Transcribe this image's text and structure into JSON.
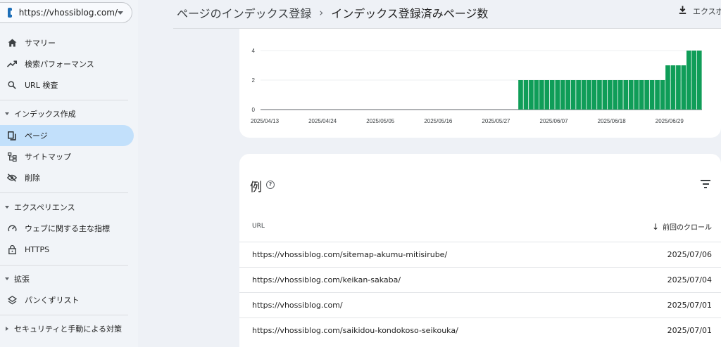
{
  "property": {
    "url": "https://vhossiblog.com/"
  },
  "sidebar": {
    "items": [
      {
        "label": "サマリー",
        "icon": "home-icon"
      },
      {
        "label": "検索パフォーマンス",
        "icon": "trending-up-icon"
      },
      {
        "label": "URL 検査",
        "icon": "search-icon"
      }
    ],
    "sections": [
      {
        "label": "インデックス作成",
        "items": [
          {
            "label": "ページ",
            "icon": "pages-icon",
            "active": true
          },
          {
            "label": "サイトマップ",
            "icon": "sitemap-icon"
          },
          {
            "label": "削除",
            "icon": "eye-off-icon"
          }
        ]
      },
      {
        "label": "エクスペリエンス",
        "items": [
          {
            "label": "ウェブに関する主な指標",
            "icon": "speed-icon"
          },
          {
            "label": "HTTPS",
            "icon": "lock-icon"
          }
        ]
      },
      {
        "label": "拡張",
        "items": [
          {
            "label": "パンくずリスト",
            "icon": "layers-icon"
          }
        ]
      },
      {
        "label": "セキュリティと手動による対策",
        "collapsed": true,
        "items": []
      }
    ]
  },
  "header": {
    "breadcrumb_parent": "ページのインデックス登録",
    "breadcrumb_current": "インデックス登録済みページ数",
    "export_label": "エクスポ"
  },
  "chart_data": {
    "type": "bar",
    "y_ticks": [
      0,
      2,
      4
    ],
    "ylim": [
      0,
      4
    ],
    "x_tick_labels": [
      "2025/04/13",
      "2025/04/24",
      "2025/05/05",
      "2025/05/16",
      "2025/05/27",
      "2025/06/07",
      "2025/06/18",
      "2025/06/29"
    ],
    "x_start": "2025/04/13",
    "x_end": "2025/07/06",
    "bar_color": "#0f9d58",
    "series": [
      {
        "from": "2025/04/13",
        "to": "2025/05/31",
        "value": 0
      },
      {
        "from": "2025/06/01",
        "to": "2025/06/28",
        "value": 2
      },
      {
        "from": "2025/06/29",
        "to": "2025/07/02",
        "value": 3
      },
      {
        "from": "2025/07/03",
        "to": "2025/07/05",
        "value": 4
      }
    ],
    "grid": true
  },
  "examples": {
    "title": "例",
    "col_url": "URL",
    "col_crawl": "前回のクロール",
    "rows": [
      {
        "url": "https://vhossiblog.com/sitemap-akumu-mitisirube/",
        "date": "2025/07/06"
      },
      {
        "url": "https://vhossiblog.com/keikan-sakaba/",
        "date": "2025/07/04"
      },
      {
        "url": "https://vhossiblog.com/",
        "date": "2025/07/01"
      },
      {
        "url": "https://vhossiblog.com/saikidou-kondokoso-seikouka/",
        "date": "2025/07/01"
      }
    ]
  }
}
